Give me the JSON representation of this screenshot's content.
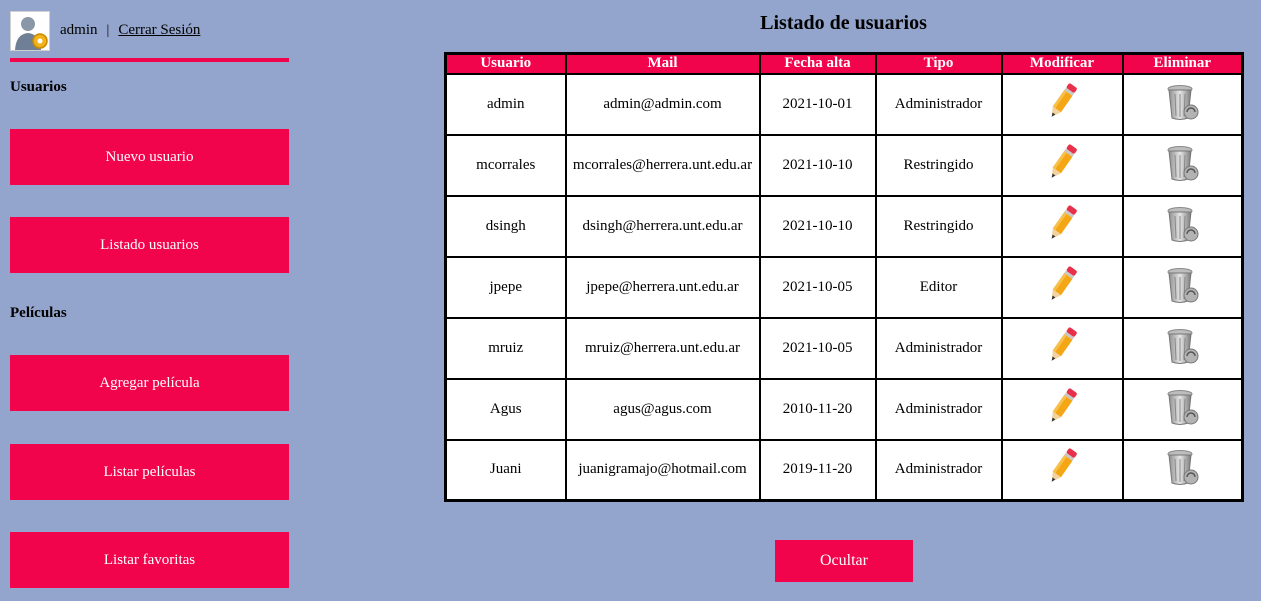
{
  "header": {
    "username": "admin",
    "separator": "|",
    "logout_label": "Cerrar Sesión"
  },
  "sidebar": {
    "sections": [
      {
        "title": "Usuarios",
        "items": [
          "Nuevo usuario",
          "Listado usuarios"
        ]
      },
      {
        "title": "Películas",
        "items": [
          "Agregar película",
          "Listar películas",
          "Listar favoritas"
        ]
      }
    ]
  },
  "main": {
    "title": "Listado de usuarios",
    "columns": [
      "Usuario",
      "Mail",
      "Fecha alta",
      "Tipo",
      "Modificar",
      "Eliminar"
    ],
    "rows": [
      {
        "usuario": "admin",
        "mail": "admin@admin.com",
        "fecha": "2021-10-01",
        "tipo": "Administrador"
      },
      {
        "usuario": "mcorrales",
        "mail": "mcorrales@herrera.unt.edu.ar",
        "fecha": "2021-10-10",
        "tipo": "Restringido"
      },
      {
        "usuario": "dsingh",
        "mail": "dsingh@herrera.unt.edu.ar",
        "fecha": "2021-10-10",
        "tipo": "Restringido"
      },
      {
        "usuario": "jpepe",
        "mail": "jpepe@herrera.unt.edu.ar",
        "fecha": "2021-10-05",
        "tipo": "Editor"
      },
      {
        "usuario": "mruiz",
        "mail": "mruiz@herrera.unt.edu.ar",
        "fecha": "2021-10-05",
        "tipo": "Administrador"
      },
      {
        "usuario": "Agus",
        "mail": "agus@agus.com",
        "fecha": "2010-11-20",
        "tipo": "Administrador"
      },
      {
        "usuario": "Juani",
        "mail": "juanigramajo@hotmail.com",
        "fecha": "2019-11-20",
        "tipo": "Administrador"
      }
    ],
    "hide_label": "Ocultar"
  },
  "icons": {
    "edit": "pencil-icon",
    "delete": "trash-icon",
    "avatar": "user-settings-icon"
  },
  "colors": {
    "background": "#93a5cc",
    "accent": "#f2044d"
  }
}
